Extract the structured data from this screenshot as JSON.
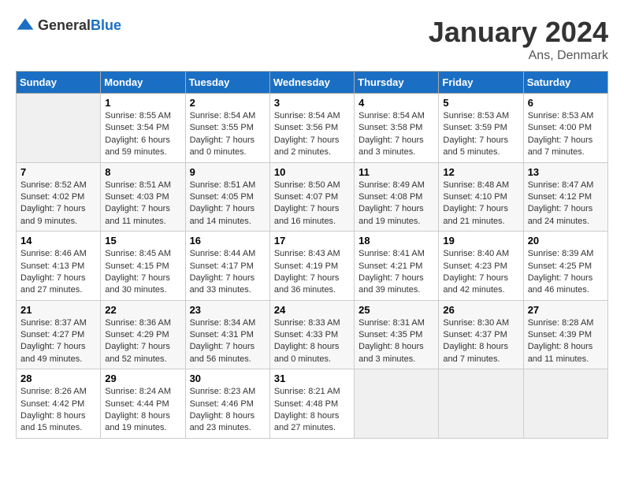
{
  "logo": {
    "text_general": "General",
    "text_blue": "Blue"
  },
  "title": "January 2024",
  "location": "Ans, Denmark",
  "weekdays": [
    "Sunday",
    "Monday",
    "Tuesday",
    "Wednesday",
    "Thursday",
    "Friday",
    "Saturday"
  ],
  "weeks": [
    [
      {
        "day": "",
        "sunrise": "",
        "sunset": "",
        "daylight": ""
      },
      {
        "day": "1",
        "sunrise": "Sunrise: 8:55 AM",
        "sunset": "Sunset: 3:54 PM",
        "daylight": "Daylight: 6 hours and 59 minutes."
      },
      {
        "day": "2",
        "sunrise": "Sunrise: 8:54 AM",
        "sunset": "Sunset: 3:55 PM",
        "daylight": "Daylight: 7 hours and 0 minutes."
      },
      {
        "day": "3",
        "sunrise": "Sunrise: 8:54 AM",
        "sunset": "Sunset: 3:56 PM",
        "daylight": "Daylight: 7 hours and 2 minutes."
      },
      {
        "day": "4",
        "sunrise": "Sunrise: 8:54 AM",
        "sunset": "Sunset: 3:58 PM",
        "daylight": "Daylight: 7 hours and 3 minutes."
      },
      {
        "day": "5",
        "sunrise": "Sunrise: 8:53 AM",
        "sunset": "Sunset: 3:59 PM",
        "daylight": "Daylight: 7 hours and 5 minutes."
      },
      {
        "day": "6",
        "sunrise": "Sunrise: 8:53 AM",
        "sunset": "Sunset: 4:00 PM",
        "daylight": "Daylight: 7 hours and 7 minutes."
      }
    ],
    [
      {
        "day": "7",
        "sunrise": "Sunrise: 8:52 AM",
        "sunset": "Sunset: 4:02 PM",
        "daylight": "Daylight: 7 hours and 9 minutes."
      },
      {
        "day": "8",
        "sunrise": "Sunrise: 8:51 AM",
        "sunset": "Sunset: 4:03 PM",
        "daylight": "Daylight: 7 hours and 11 minutes."
      },
      {
        "day": "9",
        "sunrise": "Sunrise: 8:51 AM",
        "sunset": "Sunset: 4:05 PM",
        "daylight": "Daylight: 7 hours and 14 minutes."
      },
      {
        "day": "10",
        "sunrise": "Sunrise: 8:50 AM",
        "sunset": "Sunset: 4:07 PM",
        "daylight": "Daylight: 7 hours and 16 minutes."
      },
      {
        "day": "11",
        "sunrise": "Sunrise: 8:49 AM",
        "sunset": "Sunset: 4:08 PM",
        "daylight": "Daylight: 7 hours and 19 minutes."
      },
      {
        "day": "12",
        "sunrise": "Sunrise: 8:48 AM",
        "sunset": "Sunset: 4:10 PM",
        "daylight": "Daylight: 7 hours and 21 minutes."
      },
      {
        "day": "13",
        "sunrise": "Sunrise: 8:47 AM",
        "sunset": "Sunset: 4:12 PM",
        "daylight": "Daylight: 7 hours and 24 minutes."
      }
    ],
    [
      {
        "day": "14",
        "sunrise": "Sunrise: 8:46 AM",
        "sunset": "Sunset: 4:13 PM",
        "daylight": "Daylight: 7 hours and 27 minutes."
      },
      {
        "day": "15",
        "sunrise": "Sunrise: 8:45 AM",
        "sunset": "Sunset: 4:15 PM",
        "daylight": "Daylight: 7 hours and 30 minutes."
      },
      {
        "day": "16",
        "sunrise": "Sunrise: 8:44 AM",
        "sunset": "Sunset: 4:17 PM",
        "daylight": "Daylight: 7 hours and 33 minutes."
      },
      {
        "day": "17",
        "sunrise": "Sunrise: 8:43 AM",
        "sunset": "Sunset: 4:19 PM",
        "daylight": "Daylight: 7 hours and 36 minutes."
      },
      {
        "day": "18",
        "sunrise": "Sunrise: 8:41 AM",
        "sunset": "Sunset: 4:21 PM",
        "daylight": "Daylight: 7 hours and 39 minutes."
      },
      {
        "day": "19",
        "sunrise": "Sunrise: 8:40 AM",
        "sunset": "Sunset: 4:23 PM",
        "daylight": "Daylight: 7 hours and 42 minutes."
      },
      {
        "day": "20",
        "sunrise": "Sunrise: 8:39 AM",
        "sunset": "Sunset: 4:25 PM",
        "daylight": "Daylight: 7 hours and 46 minutes."
      }
    ],
    [
      {
        "day": "21",
        "sunrise": "Sunrise: 8:37 AM",
        "sunset": "Sunset: 4:27 PM",
        "daylight": "Daylight: 7 hours and 49 minutes."
      },
      {
        "day": "22",
        "sunrise": "Sunrise: 8:36 AM",
        "sunset": "Sunset: 4:29 PM",
        "daylight": "Daylight: 7 hours and 52 minutes."
      },
      {
        "day": "23",
        "sunrise": "Sunrise: 8:34 AM",
        "sunset": "Sunset: 4:31 PM",
        "daylight": "Daylight: 7 hours and 56 minutes."
      },
      {
        "day": "24",
        "sunrise": "Sunrise: 8:33 AM",
        "sunset": "Sunset: 4:33 PM",
        "daylight": "Daylight: 8 hours and 0 minutes."
      },
      {
        "day": "25",
        "sunrise": "Sunrise: 8:31 AM",
        "sunset": "Sunset: 4:35 PM",
        "daylight": "Daylight: 8 hours and 3 minutes."
      },
      {
        "day": "26",
        "sunrise": "Sunrise: 8:30 AM",
        "sunset": "Sunset: 4:37 PM",
        "daylight": "Daylight: 8 hours and 7 minutes."
      },
      {
        "day": "27",
        "sunrise": "Sunrise: 8:28 AM",
        "sunset": "Sunset: 4:39 PM",
        "daylight": "Daylight: 8 hours and 11 minutes."
      }
    ],
    [
      {
        "day": "28",
        "sunrise": "Sunrise: 8:26 AM",
        "sunset": "Sunset: 4:42 PM",
        "daylight": "Daylight: 8 hours and 15 minutes."
      },
      {
        "day": "29",
        "sunrise": "Sunrise: 8:24 AM",
        "sunset": "Sunset: 4:44 PM",
        "daylight": "Daylight: 8 hours and 19 minutes."
      },
      {
        "day": "30",
        "sunrise": "Sunrise: 8:23 AM",
        "sunset": "Sunset: 4:46 PM",
        "daylight": "Daylight: 8 hours and 23 minutes."
      },
      {
        "day": "31",
        "sunrise": "Sunrise: 8:21 AM",
        "sunset": "Sunset: 4:48 PM",
        "daylight": "Daylight: 8 hours and 27 minutes."
      },
      {
        "day": "",
        "sunrise": "",
        "sunset": "",
        "daylight": ""
      },
      {
        "day": "",
        "sunrise": "",
        "sunset": "",
        "daylight": ""
      },
      {
        "day": "",
        "sunrise": "",
        "sunset": "",
        "daylight": ""
      }
    ]
  ]
}
